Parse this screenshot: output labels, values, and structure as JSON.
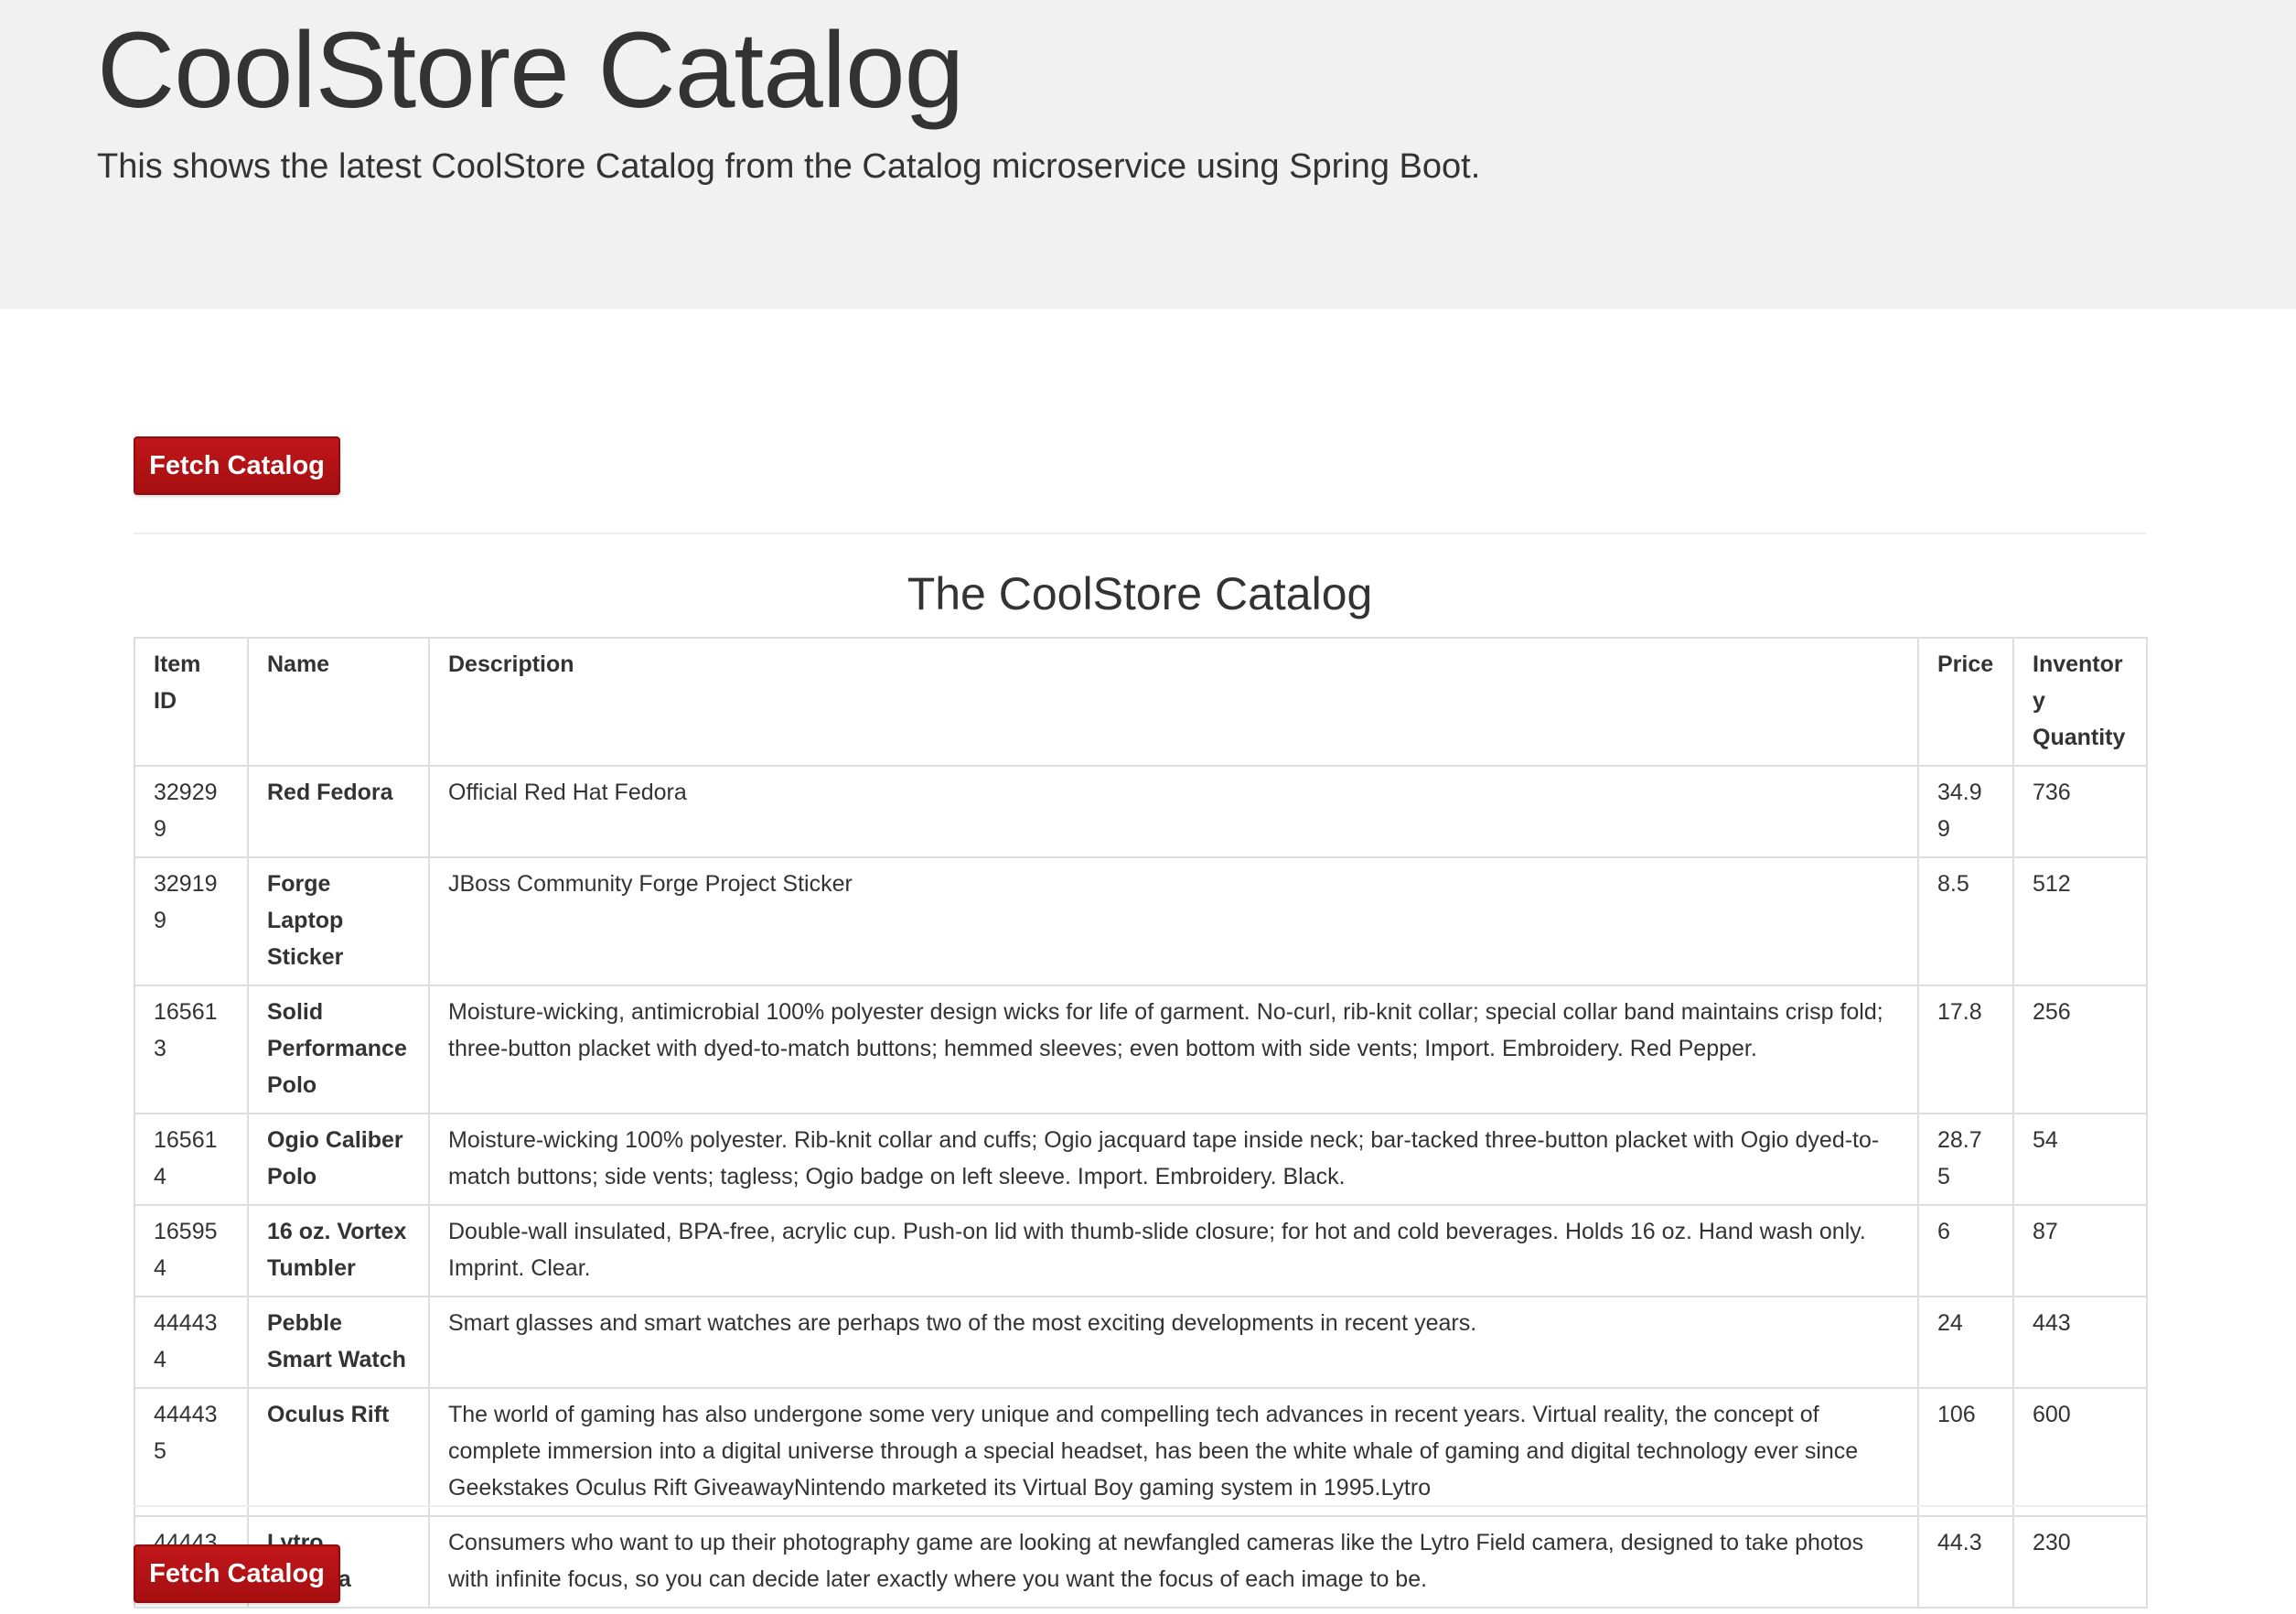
{
  "header": {
    "title": "CoolStore Catalog",
    "subtitle": "This shows the latest CoolStore Catalog from the Catalog microservice using Spring Boot."
  },
  "buttons": {
    "fetch_label": "Fetch Catalog"
  },
  "catalog": {
    "title": "The CoolStore Catalog",
    "columns": [
      "Item ID",
      "Name",
      "Description",
      "Price",
      "Inventory Quantity"
    ],
    "rows": [
      {
        "id": "329299",
        "name": "Red Fedora",
        "description": "Official Red Hat Fedora",
        "price": "34.99",
        "quantity": "736"
      },
      {
        "id": "329199",
        "name": "Forge Laptop Sticker",
        "description": "JBoss Community Forge Project Sticker",
        "price": "8.5",
        "quantity": "512"
      },
      {
        "id": "165613",
        "name": "Solid Performance Polo",
        "description": "Moisture-wicking, antimicrobial 100% polyester design wicks for life of garment. No-curl, rib-knit collar; special collar band maintains crisp fold; three-button placket with dyed-to-match buttons; hemmed sleeves; even bottom with side vents; Import. Embroidery. Red Pepper.",
        "price": "17.8",
        "quantity": "256"
      },
      {
        "id": "165614",
        "name": "Ogio Caliber Polo",
        "description": "Moisture-wicking 100% polyester. Rib-knit collar and cuffs; Ogio jacquard tape inside neck; bar-tacked three-button placket with Ogio dyed-to-match buttons; side vents; tagless; Ogio badge on left sleeve. Import. Embroidery. Black.",
        "price": "28.75",
        "quantity": "54"
      },
      {
        "id": "165954",
        "name": "16 oz. Vortex Tumbler",
        "description": "Double-wall insulated, BPA-free, acrylic cup. Push-on lid with thumb-slide closure; for hot and cold beverages. Holds 16 oz. Hand wash only. Imprint. Clear.",
        "price": "6",
        "quantity": "87"
      },
      {
        "id": "444434",
        "name": "Pebble Smart Watch",
        "description": "Smart glasses and smart watches are perhaps two of the most exciting developments in recent years.",
        "price": "24",
        "quantity": "443"
      },
      {
        "id": "444435",
        "name": "Oculus Rift",
        "description": "The world of gaming has also undergone some very unique and compelling tech advances in recent years. Virtual reality, the concept of complete immersion into a digital universe through a special headset, has been the white whale of gaming and digital technology ever since Geekstakes Oculus Rift GiveawayNintendo marketed its Virtual Boy gaming system in 1995.Lytro",
        "price": "106",
        "quantity": "600"
      },
      {
        "id": "444436",
        "name": "Lytro Camera",
        "description": "Consumers who want to up their photography game are looking at newfangled cameras like the Lytro Field camera, designed to take photos with infinite focus, so you can decide later exactly where you want the focus of each image to be.",
        "price": "44.3",
        "quantity": "230"
      }
    ]
  },
  "colors": {
    "header_bg": "#f1f1f1",
    "button_bg": "#b21215",
    "border": "#dddddd"
  }
}
